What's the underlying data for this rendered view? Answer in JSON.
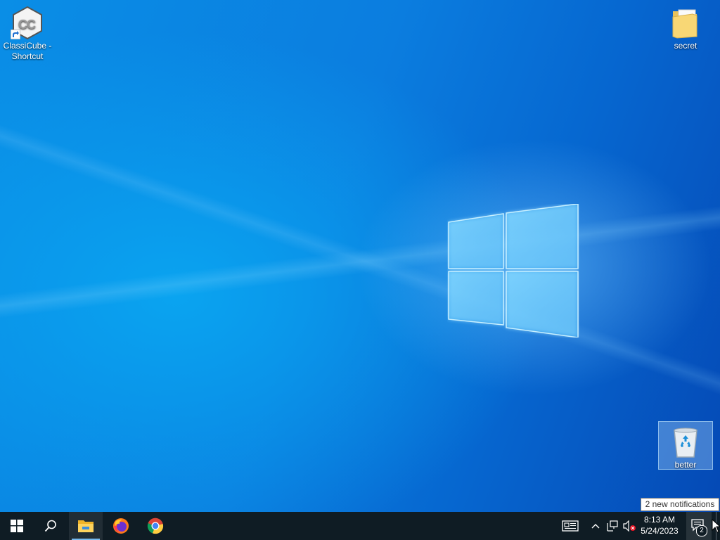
{
  "desktop": {
    "icons": [
      {
        "label": "ClassiCube -\nShortcut",
        "label_line1": "ClassiCube -",
        "label_line2": "Shortcut",
        "icon": "classicube-icon",
        "shortcut": true
      },
      {
        "label": "secret",
        "icon": "folder-icon"
      },
      {
        "label": "better",
        "icon": "recycle-bin-icon",
        "selected": true
      }
    ]
  },
  "taskbar": {
    "start": {
      "icon": "windows-start-icon"
    },
    "search": {
      "icon": "search-icon"
    },
    "pinned": [
      {
        "name": "File Explorer",
        "icon": "file-explorer-icon",
        "active": true
      },
      {
        "name": "Firefox",
        "icon": "firefox-icon"
      },
      {
        "name": "Chrome",
        "icon": "chrome-icon"
      }
    ],
    "tray": {
      "news_icon": "news-and-interests-icon",
      "overflow_icon": "chevron-up-icon",
      "network_icon": "network-icon",
      "volume_icon": "volume-muted-icon",
      "time": "8:13 AM",
      "date": "5/24/2023",
      "notifications_icon": "action-center-icon",
      "notification_count": "2"
    },
    "tooltip": "2 new notifications"
  },
  "colors": {
    "taskbar": "#0f1c24",
    "accent": "#76b9ed",
    "wallpaper": "#0b7ddf"
  }
}
